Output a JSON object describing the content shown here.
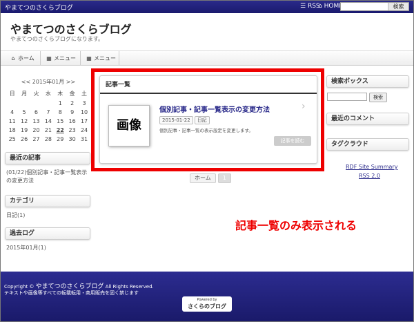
{
  "topbar": {
    "site_name": "やまてつのさくらブログ",
    "rss_label": "RSS",
    "home_label": "HOME",
    "search_button": "検索"
  },
  "header": {
    "title": "やまてつのさくらブログ",
    "description": "やまてつのさくらブログになります。"
  },
  "nav": {
    "items": [
      {
        "label": "ホーム",
        "icon": "home-icon"
      },
      {
        "label": "メニュー",
        "icon": "grid-icon"
      },
      {
        "label": "メニュー",
        "icon": "grid-icon"
      }
    ]
  },
  "calendar": {
    "header": "<< 2015年01月 >>",
    "weekdays": [
      "日",
      "月",
      "火",
      "水",
      "木",
      "金",
      "土"
    ],
    "days": [
      "",
      "",
      "",
      "",
      "1",
      "2",
      "3",
      "4",
      "5",
      "6",
      "7",
      "8",
      "9",
      "10",
      "11",
      "12",
      "13",
      "14",
      "15",
      "16",
      "17",
      "18",
      "19",
      "20",
      "21",
      "22",
      "23",
      "24",
      "25",
      "26",
      "27",
      "28",
      "29",
      "30",
      "31"
    ]
  },
  "left": {
    "recent_posts_title": "最近の記事",
    "recent_post_link": "(01/22)個別記事・記事一覧表示の変更方法",
    "category_title": "カテゴリ",
    "category_item": "日記(1)",
    "archive_title": "過去ログ",
    "archive_item": "2015年01月(1)"
  },
  "main": {
    "section_title": "記事一覧",
    "thumb_label": "画像",
    "post_title": "個別記事・記事一覧表示の変更方法",
    "post_date": "2015-01-22",
    "post_category": "日記",
    "post_excerpt": "個別記事・記事一覧の表示設定を変更します。",
    "read_more": "記事を読む",
    "pager_home": "ホーム",
    "pager_current": "1",
    "callout": "記事一覧のみ表示される"
  },
  "right": {
    "search_title": "検索ボックス",
    "search_button": "検索",
    "comments_title": "最近のコメント",
    "tagcloud_title": "タグクラウド",
    "rdf_link": "RDF Site Summary",
    "rss_link": "RSS 2.0"
  },
  "footer": {
    "copyright_prefix": "Copyright ©",
    "copyright_name": "やまてつのさくらブログ",
    "copyright_suffix": "All Rights Reserved.",
    "note": "テキストや画像等すべての転載転用・商用販売を固く禁じます",
    "powered_small": "Powered by",
    "powered_logo": "さくらのブログ"
  },
  "colors": {
    "accent": "#2a2a8a",
    "highlight": "#e00000"
  }
}
